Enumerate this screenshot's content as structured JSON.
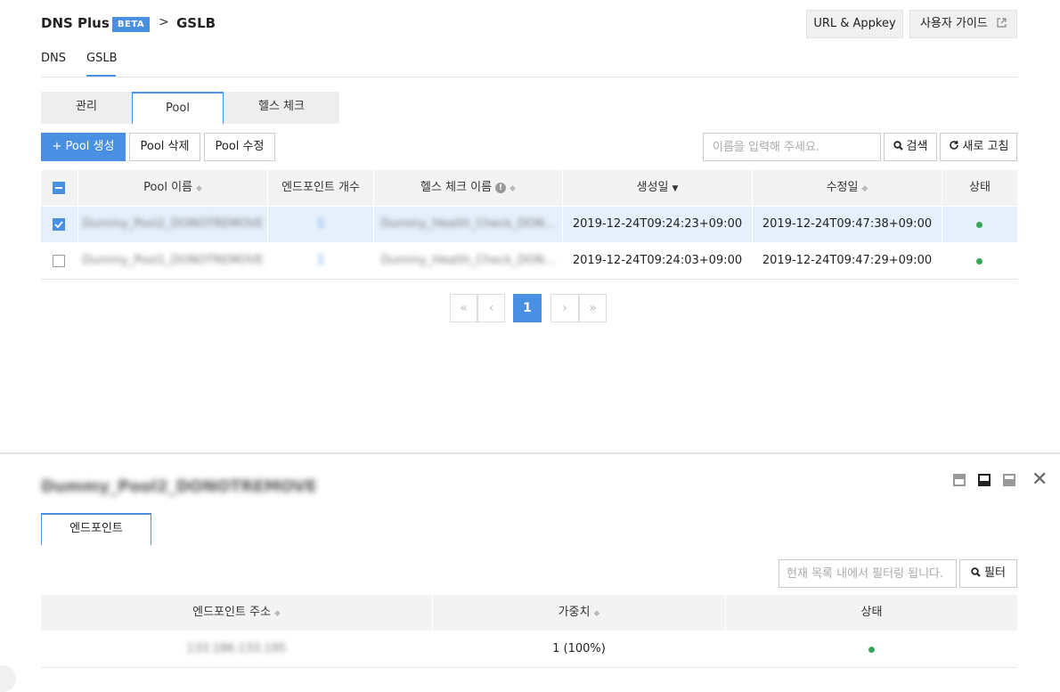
{
  "header": {
    "brand": "DNS Plus",
    "badge": "BETA",
    "separator": ">",
    "current": "GSLB",
    "buttons": {
      "url_appkey": "URL & Appkey",
      "user_guide": "사용자 가이드"
    }
  },
  "top_nav": [
    "DNS",
    "GSLB"
  ],
  "sub_tabs": [
    "관리",
    "Pool",
    "헬스 체크"
  ],
  "toolbar": {
    "create": "+ Pool 생성",
    "delete": "Pool 삭제",
    "edit": "Pool 수정",
    "search_placeholder": "이름을 입력해 주세요.",
    "search": "검색",
    "refresh": "새로 고침"
  },
  "table": {
    "columns": [
      "Pool 이름",
      "엔드포인트 개수",
      "헬스 체크 이름",
      "생성일",
      "수정일",
      "상태"
    ],
    "rows": [
      {
        "name": "Dummy_Pool2_DONOTREMOVE",
        "endpoints": "1",
        "health_check": "Dummy_Health_Check_DON...",
        "created": "2019-12-24T09:24:23+09:00",
        "modified": "2019-12-24T09:47:38+09:00",
        "checked": true,
        "status_color": "#3aa757"
      },
      {
        "name": "Dummy_Pool1_DONOTREMOVE",
        "endpoints": "1",
        "health_check": "Dummy_Health_Check_DON...",
        "created": "2019-12-24T09:24:03+09:00",
        "modified": "2019-12-24T09:47:29+09:00",
        "checked": false,
        "status_color": "#3aa757"
      }
    ]
  },
  "pagination": {
    "first": "«",
    "prev": "‹",
    "current": "1",
    "next": "›",
    "last": "»"
  },
  "detail": {
    "title": "Dummy_Pool2_DONOTREMOVE",
    "tab": "엔드포인트",
    "filter_placeholder": "현재 목록 내에서 필터링 됩니다.",
    "filter": "필터",
    "columns": [
      "엔드포인트 주소",
      "가중치",
      "상태"
    ],
    "rows": [
      {
        "address": "133.186.133.195",
        "weight": "1 (100%)",
        "status_color": "#3aa757"
      }
    ]
  },
  "colors": {
    "accent": "#4a90e2",
    "status_ok": "#3aa757"
  }
}
